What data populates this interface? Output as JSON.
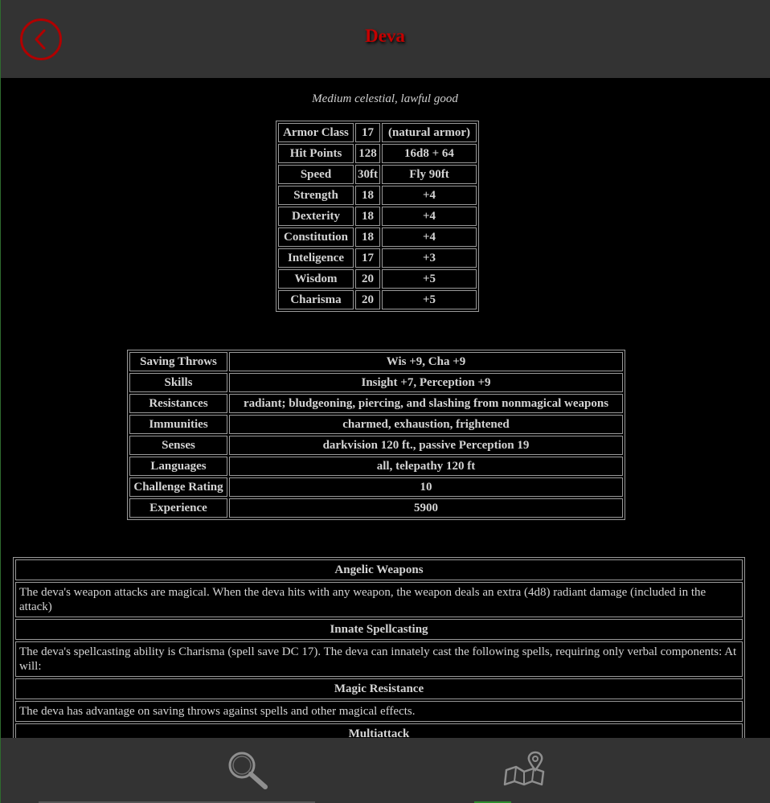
{
  "header": {
    "title": "Deva",
    "back_icon": "chevron-left-circle-icon"
  },
  "subtitle": "Medium celestial, lawful good",
  "stats": [
    {
      "label": "Armor Class",
      "value": "17",
      "extra": "(natural armor)"
    },
    {
      "label": "Hit Points",
      "value": "128",
      "extra": "16d8 + 64"
    },
    {
      "label": "Speed",
      "value": "30ft",
      "extra": "Fly 90ft"
    },
    {
      "label": "Strength",
      "value": "18",
      "extra": "+4"
    },
    {
      "label": "Dexterity",
      "value": "18",
      "extra": "+4"
    },
    {
      "label": "Constitution",
      "value": "18",
      "extra": "+4"
    },
    {
      "label": "Inteligence",
      "value": "17",
      "extra": "+3"
    },
    {
      "label": "Wisdom",
      "value": "20",
      "extra": "+5"
    },
    {
      "label": "Charisma",
      "value": "20",
      "extra": "+5"
    }
  ],
  "info": [
    {
      "label": "Saving Throws",
      "value": "Wis +9, Cha +9"
    },
    {
      "label": "Skills",
      "value": "Insight +7, Perception +9"
    },
    {
      "label": "Resistances",
      "value": "radiant; bludgeoning, piercing, and slashing from nonmagical weapons"
    },
    {
      "label": "Immunities",
      "value": "charmed, exhaustion, frightened"
    },
    {
      "label": "Senses",
      "value": "darkvision 120 ft., passive Perception 19"
    },
    {
      "label": "Languages",
      "value": "all, telepathy 120 ft"
    },
    {
      "label": "Challenge Rating",
      "value": "10"
    },
    {
      "label": "Experience",
      "value": "5900"
    }
  ],
  "traits": [
    {
      "title": "Angelic Weapons",
      "desc": "The deva's weapon attacks are magical. When the deva hits with any weapon, the weapon deals an extra (4d8) radiant damage (included in the attack)"
    },
    {
      "title": "Innate Spellcasting",
      "desc": "The deva's spellcasting ability is Charisma (spell save DC 17). The deva can innately cast the following spells, requiring only verbal components: At will:"
    },
    {
      "title": "Magic Resistance",
      "desc": "The deva has advantage on saving throws against spells and other magical effects."
    },
    {
      "title": "Multiattack",
      "desc": ""
    }
  ],
  "footer": {
    "search_icon": "magnifier-icon",
    "map_icon": "map-pin-icon"
  },
  "colors": {
    "header_bg": "#333333",
    "title": "#c40000",
    "content_bg": "#000000",
    "text": "#d4d4d4"
  }
}
